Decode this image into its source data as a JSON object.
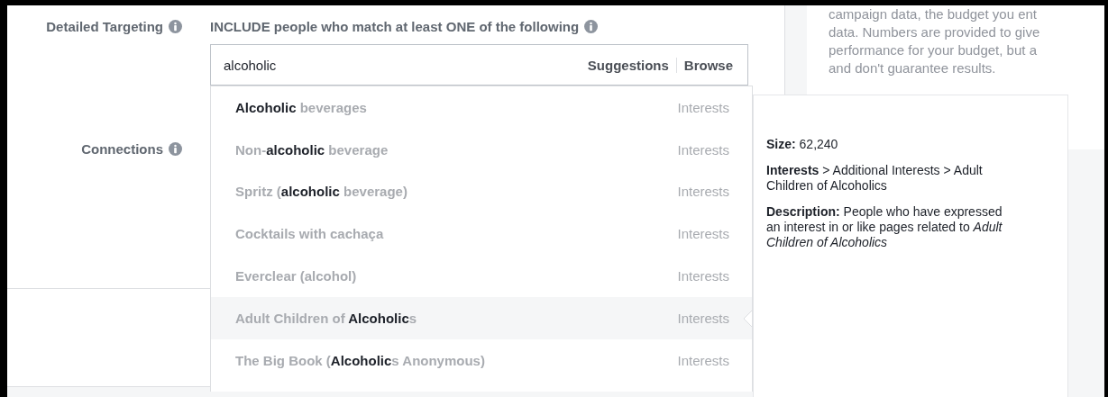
{
  "targeting": {
    "label": "Detailed Targeting",
    "include_text": "INCLUDE people who match at least ONE of the following"
  },
  "search": {
    "value": "alcoholic",
    "buttons": [
      "Suggestions",
      "Browse"
    ]
  },
  "suggestions": [
    {
      "name": "**Alcoholic** beverages",
      "category": "Interests",
      "selected": false
    },
    {
      "name": "Non-**alcoholic** beverage",
      "category": "Interests",
      "selected": false
    },
    {
      "name": "Spritz (**alcoholic** beverage)",
      "category": "Interests",
      "selected": false
    },
    {
      "name": "Cocktails with cachaça",
      "category": "Interests",
      "selected": false
    },
    {
      "name": "Everclear (alcohol)",
      "category": "Interests",
      "selected": false
    },
    {
      "name": "Adult Children of **Alcoholic**s",
      "category": "Interests",
      "selected": true
    },
    {
      "name": "The Big Book (**Alcoholic**s Anonymous)",
      "category": "Interests",
      "selected": false
    }
  ],
  "connections": {
    "label": "Connections"
  },
  "estimate_note": [
    "campaign data, the budget you ent",
    "data. Numbers are provided to give",
    "performance for your budget, but a",
    "and don't guarantee results."
  ],
  "detail": {
    "size": "**Size:** 62,240",
    "path": "**Interests** > Additional Interests > Adult Children of Alcoholics",
    "description": "**Description:** People who have expressed an interest in or like pages related to *Adult Children of Alcoholics*"
  }
}
